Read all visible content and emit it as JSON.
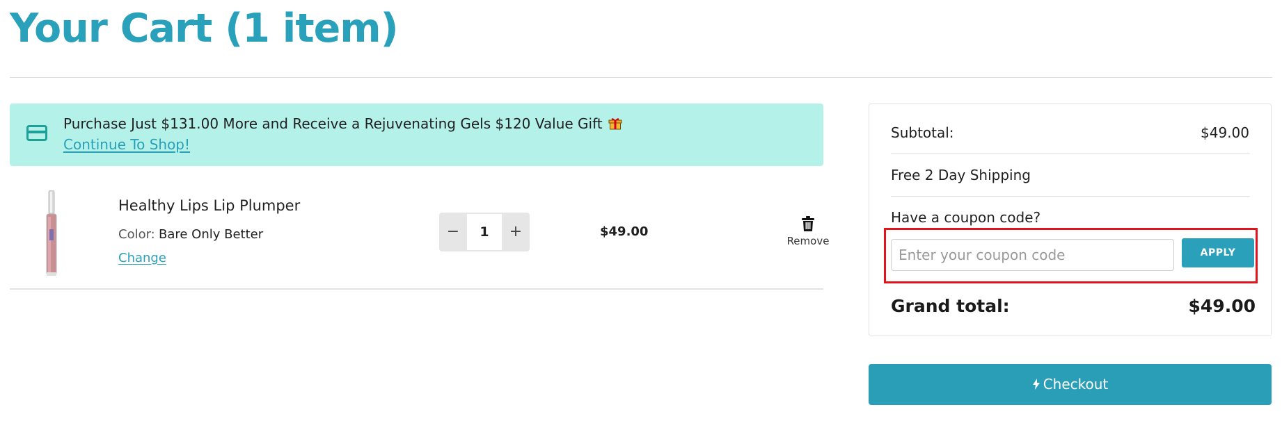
{
  "page": {
    "title": "Your Cart (1 item)"
  },
  "promo": {
    "message": "Purchase Just $131.00 More and Receive a Rejuvenating Gels $120 Value Gift",
    "link_label": "Continue To Shop!",
    "icon": "credit-card-icon",
    "gift_icon": "gift-icon"
  },
  "cart": {
    "items": [
      {
        "name": "Healthy Lips Lip Plumper",
        "color_label": "Color:",
        "color_value": "Bare Only Better",
        "change_label": "Change",
        "quantity": "1",
        "decrease_symbol": "−",
        "increase_symbol": "+",
        "price": "$49.00",
        "remove_label": "Remove"
      }
    ]
  },
  "summary": {
    "subtotal_label": "Subtotal:",
    "subtotal_value": "$49.00",
    "shipping_label": "Free 2 Day Shipping",
    "coupon_label": "Have a coupon code?",
    "coupon_placeholder": "Enter your coupon code",
    "coupon_value": "",
    "apply_label": "APPLY",
    "grand_total_label": "Grand total:",
    "grand_total_value": "$49.00"
  },
  "checkout": {
    "label": "Checkout",
    "icon": "lightning-bolt-icon"
  },
  "colors": {
    "brand_teal": "#2aa1bb",
    "promo_background": "#b4f1e9",
    "highlight_red": "#e3131b"
  }
}
